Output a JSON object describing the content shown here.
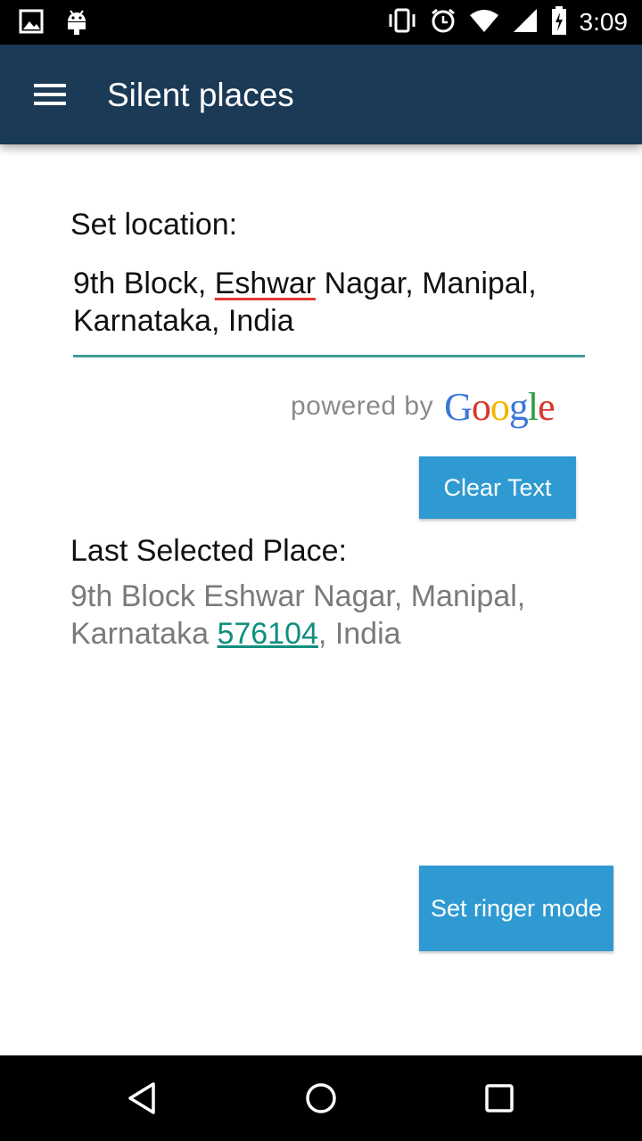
{
  "status_bar": {
    "time": "3:09",
    "icons": [
      "image-icon",
      "android-icon",
      "vibrate-icon",
      "alarm-icon",
      "wifi-icon",
      "signal-icon",
      "battery-charging-icon"
    ]
  },
  "app_bar": {
    "title": "Silent places",
    "menu_icon": "hamburger-menu-icon",
    "color": "#1b3a56"
  },
  "location_form": {
    "label": "Set location:",
    "input_value_part1": "9th Block, ",
    "input_value_misspelled": "Eshwar",
    "input_value_part2": " Nagar, Manipal, Karnataka, India",
    "powered_by_text": "powered by",
    "google_logo": [
      "G",
      "o",
      "o",
      "g",
      "l",
      "e"
    ],
    "google_colors": [
      "#3c78d8",
      "#d9382c",
      "#f2b500",
      "#3c78d8",
      "#2e9e47",
      "#d9382c"
    ],
    "clear_button_label": "Clear Text"
  },
  "last_selected": {
    "label": "Last Selected Place:",
    "value_prefix": "9th Block Eshwar Nagar, Manipal, Karnataka ",
    "postal_code": "576104",
    "value_suffix": ", India"
  },
  "actions": {
    "ringer_button_label": "Set ringer mode",
    "button_color": "#2f9ad1"
  },
  "nav_bar": {
    "buttons": [
      "back-icon",
      "home-icon",
      "recents-icon"
    ]
  }
}
